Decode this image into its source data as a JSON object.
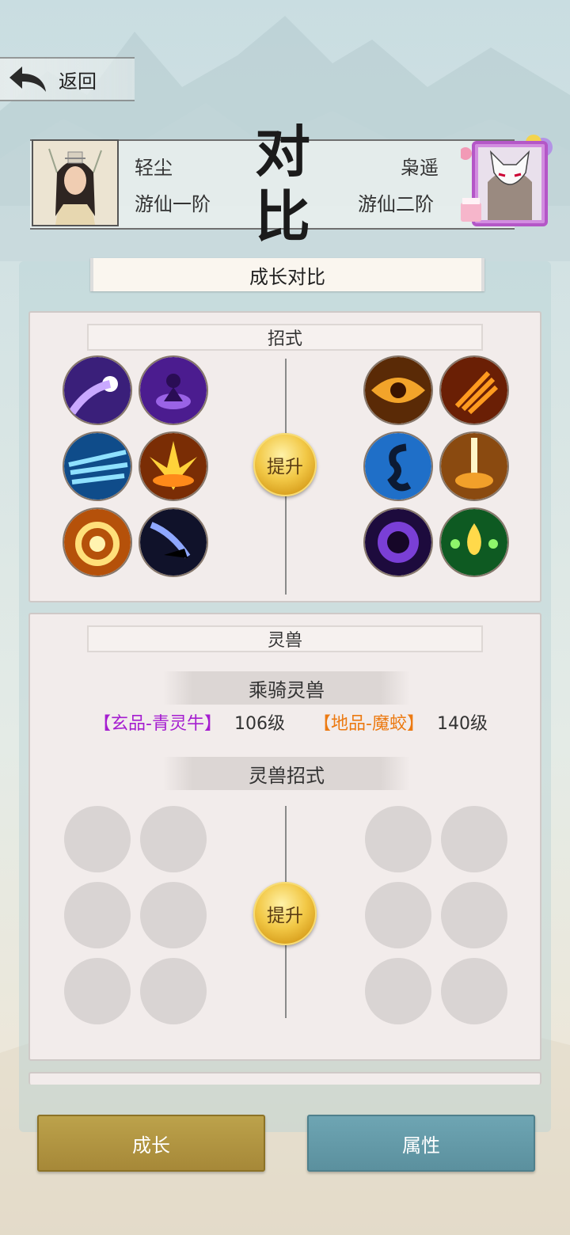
{
  "nav": {
    "back_label": "返回"
  },
  "title": {
    "char1": "对",
    "char2": "比"
  },
  "players": {
    "left": {
      "name": "轻尘",
      "rank": "游仙一阶"
    },
    "right": {
      "name": "枭遥",
      "rank": "游仙二阶"
    }
  },
  "section_header": "成长对比",
  "skills_card": {
    "title": "招式",
    "upgrade_label": "提升",
    "left_icons": [
      "purple-comet-icon",
      "purple-meditation-icon",
      "ice-slash-icon",
      "fire-burst-icon",
      "fire-vortex-icon",
      "shadow-strike-icon"
    ],
    "right_icons": [
      "fire-eye-icon",
      "fire-claw-icon",
      "blue-dragon-icon",
      "fire-pillar-icon",
      "dark-orb-icon",
      "green-flame-icon"
    ]
  },
  "beast_card": {
    "title": "灵兽",
    "mount_header": "乘骑灵兽",
    "left_mount": {
      "name": "【玄品-青灵牛】",
      "level": "106级",
      "color": "#a51dd0"
    },
    "right_mount": {
      "name": "【地品-魔蛟】",
      "level": "140级",
      "color": "#ec7a12"
    },
    "skills_header": "灵兽招式",
    "upgrade_label": "提升"
  },
  "bottom_buttons": {
    "growth": "成长",
    "attributes": "属性"
  },
  "colors": {
    "growth_button": "#b0933f",
    "attr_button": "#6499a7"
  }
}
